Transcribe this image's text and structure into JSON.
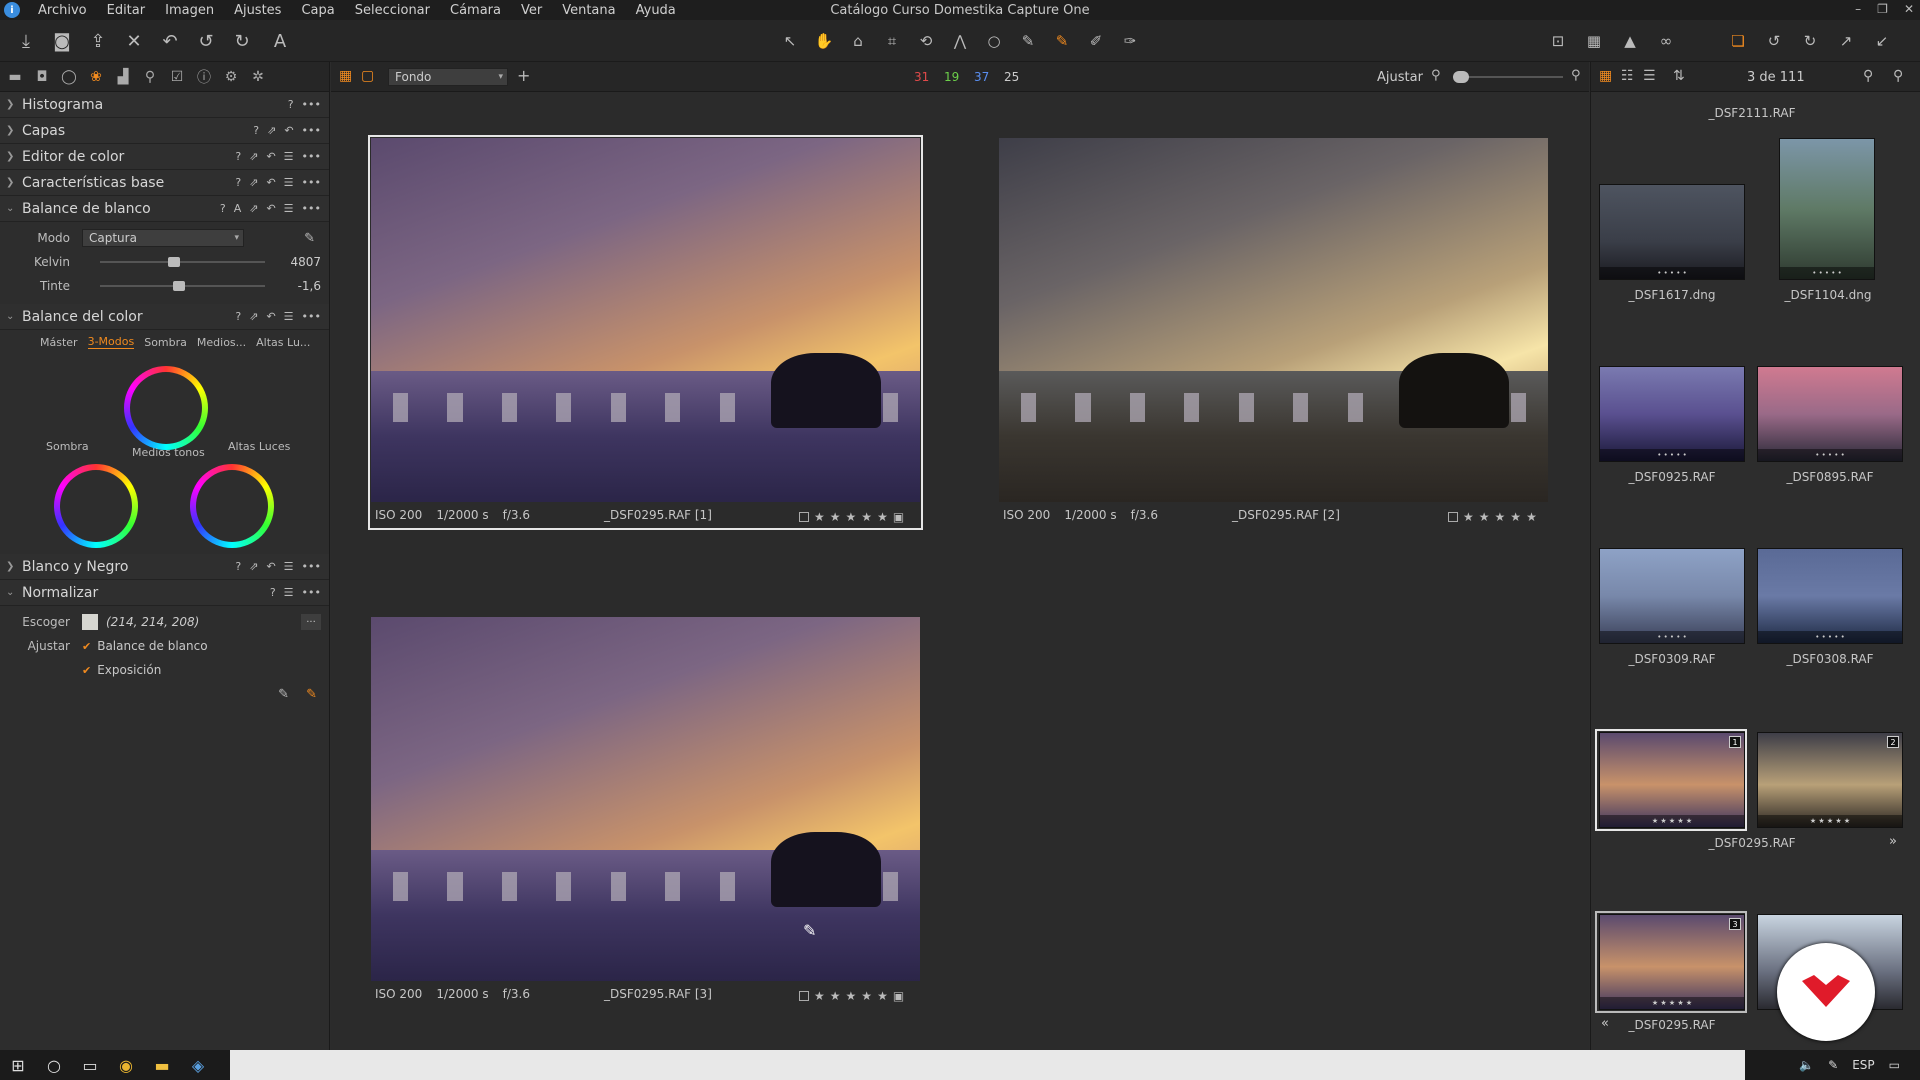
{
  "window": {
    "title": "Catálogo Curso Domestika Capture One"
  },
  "menu": [
    "Archivo",
    "Editar",
    "Imagen",
    "Ajustes",
    "Capa",
    "Seleccionar",
    "Cámara",
    "Ver",
    "Ventana",
    "Ayuda"
  ],
  "left": {
    "tools": {
      "histograma": "Histograma",
      "capas": "Capas",
      "editor_color": "Editor de color",
      "caracteristicas": "Características base",
      "balance_blanco": "Balance de blanco",
      "balance_color": "Balance del color",
      "bn": "Blanco y Negro",
      "normalizar": "Normalizar"
    },
    "wb": {
      "modo_label": "Modo",
      "modo_value": "Captura",
      "kelvin_label": "Kelvin",
      "kelvin_value": "4807",
      "kelvin_level": 0.45,
      "tinte_label": "Tinte",
      "tinte_value": "-1,6",
      "tinte_level": 0.48
    },
    "cb": {
      "tabs": [
        "Máster",
        "3-Modos",
        "Sombra",
        "Medios...",
        "Altas Lu..."
      ],
      "active": "3-Modos",
      "sombra": "Sombra",
      "medios": "Medios tonos",
      "altas": "Altas Luces"
    },
    "norm": {
      "escoger": "Escoger",
      "escoger_value": "(214, 214, 208)",
      "ajustar": "Ajustar",
      "opt1": "Balance de blanco",
      "opt2": "Exposición",
      "more": "..."
    }
  },
  "viewerbar": {
    "layer": "Fondo",
    "count_red": "31",
    "count_green": "19",
    "count_blue": "37",
    "count_white": "25",
    "fit": "Ajustar"
  },
  "viewer": {
    "photos": [
      {
        "iso": "ISO 200",
        "shutter": "1/2000 s",
        "aperture": "f/3.6",
        "name": "_DSF0295.RAF [1]"
      },
      {
        "iso": "ISO 200",
        "shutter": "1/2000 s",
        "aperture": "f/3.6",
        "name": "_DSF0295.RAF [2]"
      },
      {
        "iso": "ISO 200",
        "shutter": "1/2000 s",
        "aperture": "f/3.6",
        "name": "_DSF0295.RAF [3]"
      }
    ],
    "star": "★"
  },
  "browser": {
    "counter": "3 de 111",
    "names": {
      "top": "_DSF2111.RAF",
      "t1": "_DSF1617.dng",
      "t2": "_DSF1104.dng",
      "t3": "_DSF0925.RAF",
      "t4": "_DSF0895.RAF",
      "t5": "_DSF0309.RAF",
      "t6": "_DSF0308.RAF",
      "t7": "_DSF0295.RAF",
      "t8": "_DSF0295.RAF"
    },
    "badges": [
      "1",
      "2",
      "3"
    ],
    "nav_next": "»",
    "nav_prev": "«"
  },
  "taskbar": {
    "lang": "ESP"
  },
  "colors": {
    "accent": "#f08a1f",
    "red": "#e04a4a",
    "green": "#6ccf4a",
    "blue": "#5a8ef0"
  }
}
